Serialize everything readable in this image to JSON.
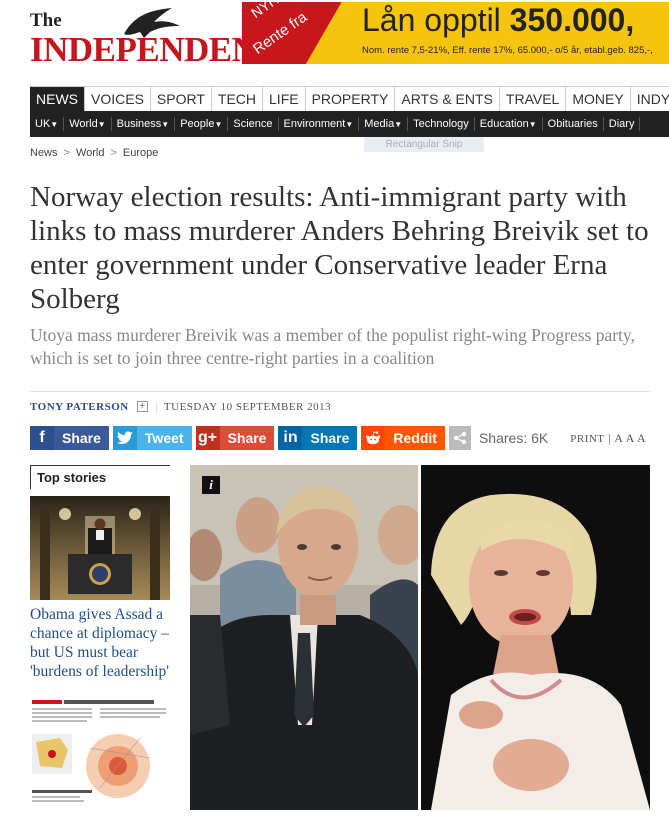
{
  "logo": {
    "the": "The",
    "name": "INDEPENDENT"
  },
  "ad": {
    "corner_1": "NYH",
    "corner_2": "Rente fra",
    "headline_prefix": "Lån opptil",
    "headline_amount": "350.000,",
    "fine_print": "Nom. rente 7,5-21%, Eff. rente 17%, 65.000,- o/5 år, etabl.geb. 825,-,"
  },
  "main_nav": [
    {
      "label": "NEWS",
      "active": true
    },
    {
      "label": "VOICES"
    },
    {
      "label": "SPORT"
    },
    {
      "label": "TECH"
    },
    {
      "label": "LIFE"
    },
    {
      "label": "PROPERTY"
    },
    {
      "label": "ARTS & ENTS"
    },
    {
      "label": "TRAVEL"
    },
    {
      "label": "MONEY"
    },
    {
      "label": "INDYBE"
    }
  ],
  "sub_nav": [
    {
      "label": "UK",
      "caret": "▼"
    },
    {
      "label": "World",
      "caret": "▼"
    },
    {
      "label": "Business",
      "caret": "▼"
    },
    {
      "label": "People",
      "caret": "▼"
    },
    {
      "label": "Science",
      "caret": ""
    },
    {
      "label": "Environment",
      "caret": "▼"
    },
    {
      "label": "Media",
      "caret": "▼"
    },
    {
      "label": "Technology",
      "caret": ""
    },
    {
      "label": "Education",
      "caret": "▼"
    },
    {
      "label": "Obituaries",
      "caret": ""
    },
    {
      "label": "Diary",
      "caret": ""
    }
  ],
  "snip_tooltip": "Rectangular Snip",
  "breadcrumb": {
    "items": [
      "News",
      "World",
      "Europe"
    ],
    "sep": ">"
  },
  "article": {
    "title": "Norway election results: Anti-immigrant party with links to mass murderer Anders Behring Breivik set to enter government under Conservative leader Erna Solberg",
    "standfirst": "Utoya mass murderer Breivik was a member of the populist right-wing Progress party, which is set to join three centre-right parties in a coalition",
    "author": "TONY PATERSON",
    "plus": "+",
    "bar": "|",
    "date": "TUESDAY 10 SEPTEMBER 2013"
  },
  "share": {
    "facebook": {
      "icon": "f",
      "label": "Share"
    },
    "twitter": {
      "icon": "t",
      "label": "Tweet"
    },
    "googleplus": {
      "icon": "g+",
      "label": "Share"
    },
    "linkedin": {
      "icon": "in",
      "label": "Share"
    },
    "reddit": {
      "icon": "●",
      "label": "Reddit"
    },
    "more_icon": "share-network-icon",
    "count": "Shares: 6K",
    "print": "PRINT",
    "sizes": "| A A A"
  },
  "top_stories": {
    "header": "Top stories",
    "story1_title": "Obama gives Assad a chance at diplomacy – but US must bear 'burdens of leadership'"
  },
  "photo": {
    "info_icon": "i"
  },
  "colors": {
    "brand_red": "#c4161c",
    "nav_dark": "#222222",
    "link_blue": "#1f4f8a"
  }
}
